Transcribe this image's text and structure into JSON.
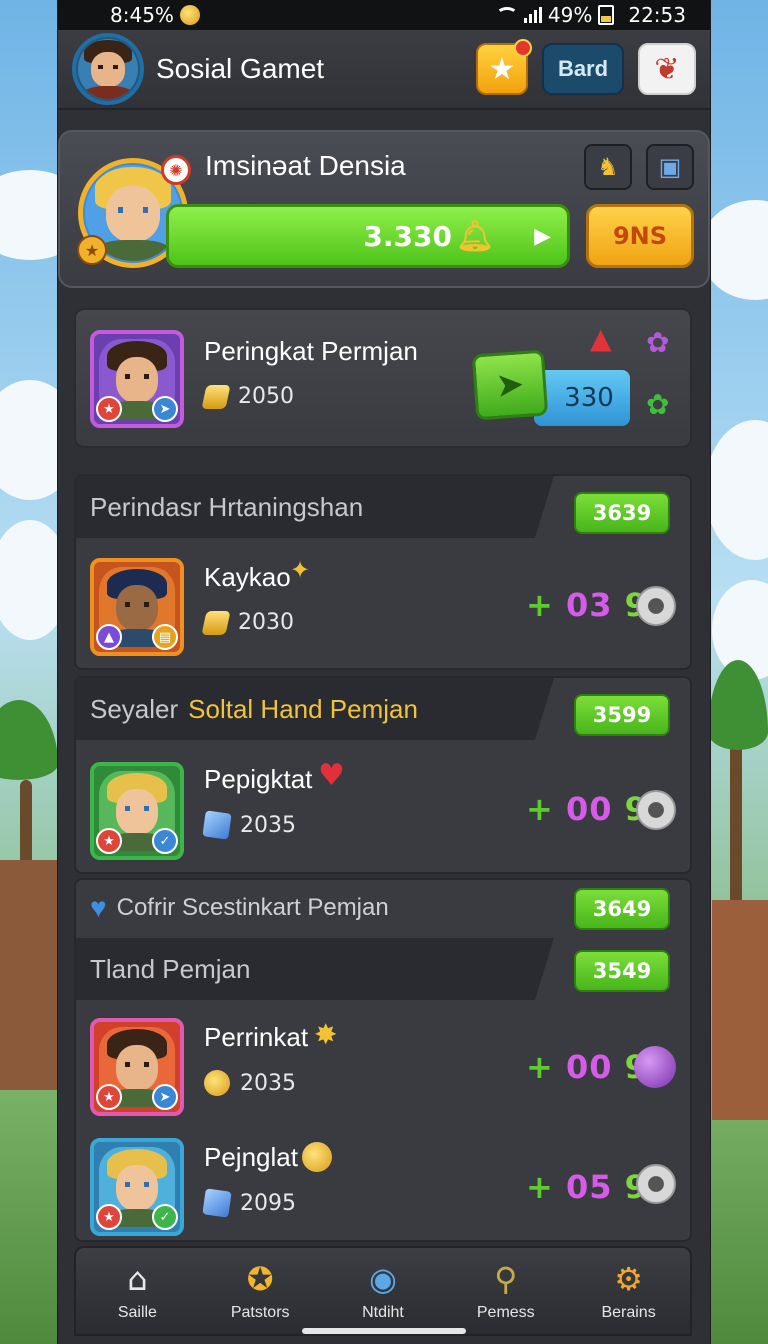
{
  "status_bar": {
    "time_left": "8:45%",
    "battery": "49%",
    "clock": "22:53"
  },
  "header": {
    "title": "Sosial Gamet",
    "bard_label": "Bard"
  },
  "profile": {
    "name": "Imsinǝat Densia",
    "xp_value": "3.330",
    "gold_button_label": "9NS"
  },
  "rank_card": {
    "title": "Peringkat Permjan",
    "coins": "2050",
    "tag_value": "330"
  },
  "sections": [
    {
      "header": "Perindasr Hrtaningshan",
      "highlight": "",
      "count": "3639",
      "rows": [
        {
          "name": "Kaykao",
          "value": "2030",
          "score_plus": "+",
          "score_mid": "03",
          "score_end": "9",
          "chip": "gold"
        }
      ]
    },
    {
      "header": "Seyaler",
      "highlight": "Soltal Hand Pemjan",
      "count": "3599",
      "rows": [
        {
          "name": "Pepigktat",
          "value": "2035",
          "score_plus": "+",
          "score_mid": "00",
          "score_end": "9",
          "chip": "gem"
        }
      ]
    },
    {
      "header": "Cofrir Scestinkart Pemjan",
      "highlight": "",
      "count": "3649",
      "rows": []
    },
    {
      "header": "Tland Pemjan",
      "highlight": "",
      "count": "3549",
      "rows": [
        {
          "name": "Perrinkat",
          "value": "2035",
          "score_plus": "+",
          "score_mid": "00",
          "score_end": "9",
          "chip": "coin"
        },
        {
          "name": "Pejnglat",
          "value": "2095",
          "score_plus": "+",
          "score_mid": "05",
          "score_end": "9",
          "chip": "gem"
        }
      ]
    }
  ],
  "bottom_nav": [
    {
      "label": "Saille",
      "icon": "home-icon"
    },
    {
      "label": "Patstors",
      "icon": "chest-icon"
    },
    {
      "label": "Ntdiht",
      "icon": "compass-icon"
    },
    {
      "label": "Pemess",
      "icon": "magnifier-icon"
    },
    {
      "label": "Berains",
      "icon": "gear-icon"
    }
  ],
  "colors": {
    "accent_green": "#5ccb2d",
    "accent_gold": "#f1c33a",
    "panel": "#393b41"
  }
}
